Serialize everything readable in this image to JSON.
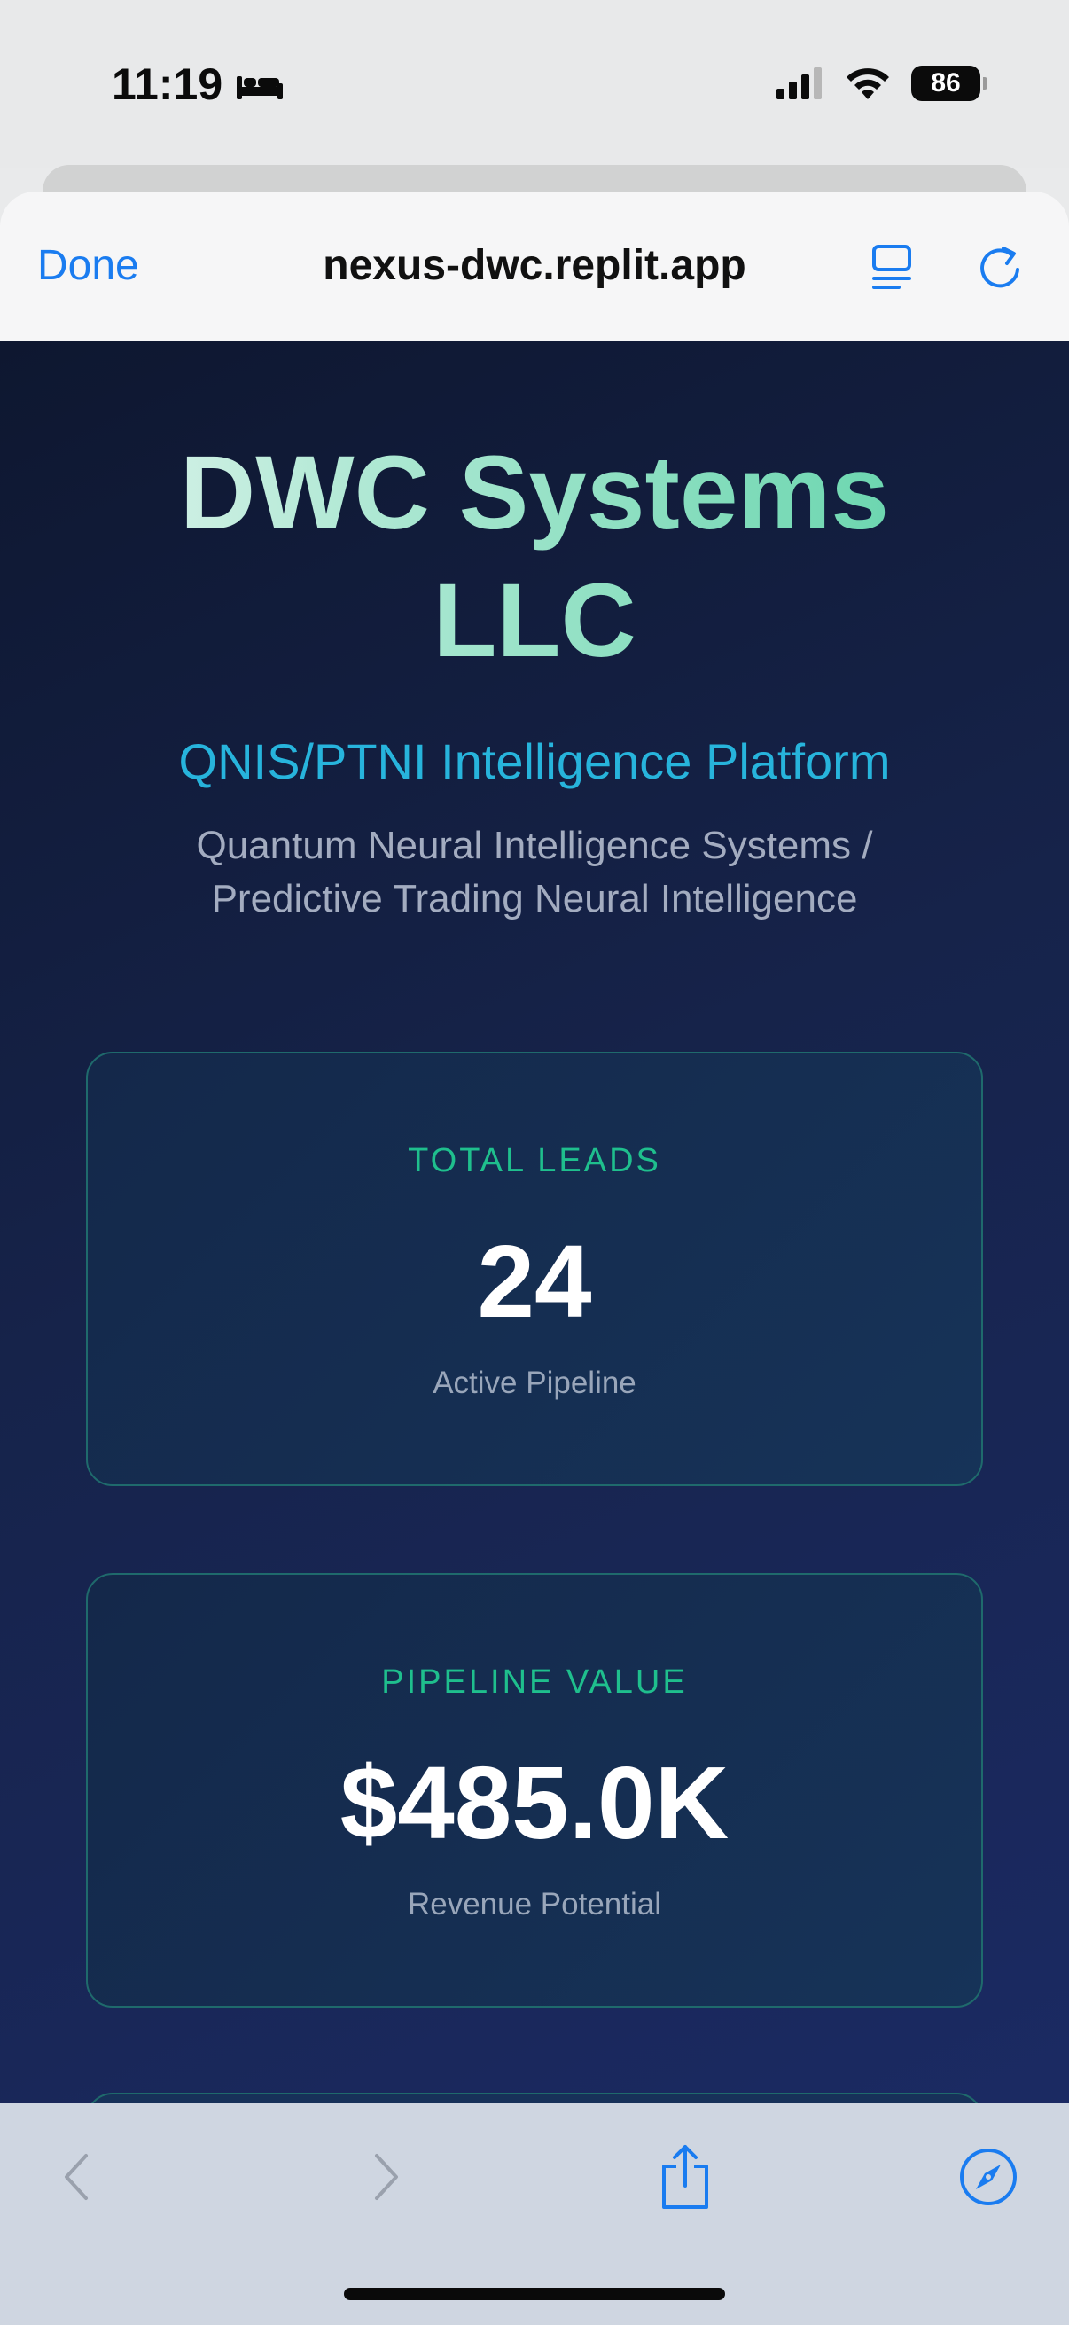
{
  "status_bar": {
    "time": "11:19",
    "battery": "86",
    "icons": [
      "sleep-bed-icon",
      "cellular-signal-icon",
      "wifi-icon",
      "battery-icon"
    ]
  },
  "browser": {
    "done_label": "Done",
    "url": "nexus-dwc.replit.app",
    "header_icons": [
      "reader-icon",
      "reload-icon"
    ],
    "accent_color": "#1a7cf0"
  },
  "hero": {
    "title_line1": "DWC Systems",
    "title_line2": "LLC",
    "subtitle": "QNIS/PTNI Intelligence Platform",
    "description_line1": "Quantum Neural Intelligence Systems /",
    "description_line2": "Predictive Trading Neural Intelligence"
  },
  "cards": [
    {
      "label": "TOTAL LEADS",
      "value": "24",
      "caption": "Active Pipeline"
    },
    {
      "label": "PIPELINE VALUE",
      "value": "$485.0K",
      "caption": "Revenue Potential"
    }
  ],
  "toolbar": {
    "icons": [
      "back-chevron-icon",
      "forward-chevron-icon",
      "share-icon",
      "compass-icon"
    ]
  },
  "colors": {
    "page_bg_dark": "#0e1730",
    "page_bg_blue": "#1b2a63",
    "card_label": "#1fbf8d",
    "subtitle": "#27b4dc",
    "title_gradient_end": "#57d0a4"
  }
}
